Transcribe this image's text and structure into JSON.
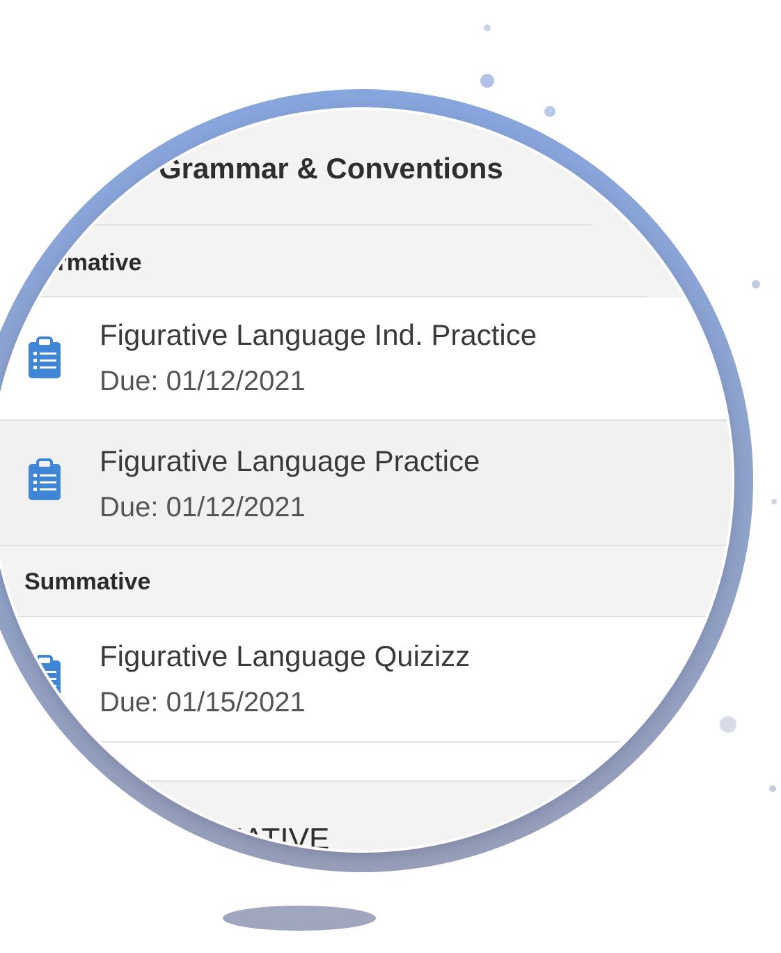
{
  "top_section": {
    "title": "Grammar & Conventions"
  },
  "groups": [
    {
      "label": "Formative",
      "items": [
        {
          "title": "Figurative Language Ind. Practice",
          "due": "Due: 01/12/2021",
          "icon": "assignment-icon"
        },
        {
          "title": "Figurative Language Practice",
          "due": "Due: 01/12/2021",
          "icon": "assignment-icon"
        }
      ]
    },
    {
      "label": "Summative",
      "items": [
        {
          "title": "Figurative Language Quizizz",
          "due": "Due: 01/15/2021",
          "icon": "assignment-icon"
        }
      ]
    }
  ],
  "bottom_section": {
    "title": "SUMMATIVE"
  },
  "colors": {
    "icon_blue": "#3f86d6",
    "ring_blue": "#7b98d3",
    "header_bg": "#f3f3f3"
  }
}
